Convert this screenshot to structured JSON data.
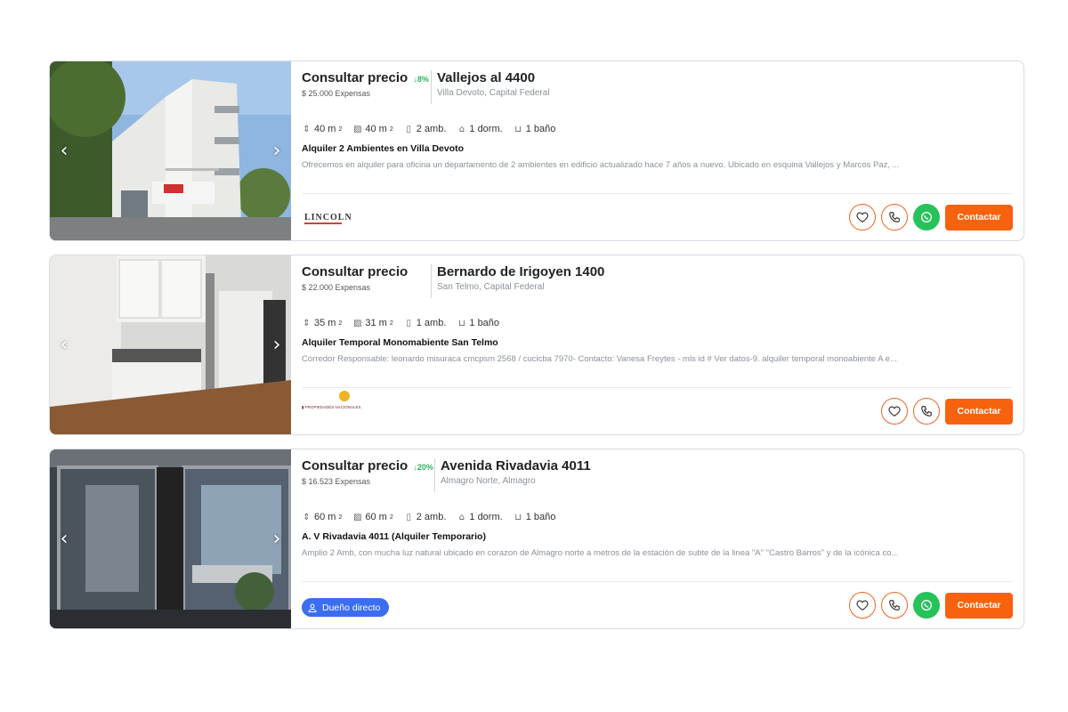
{
  "colors": {
    "accent": "#f7620e",
    "drop": "#2fb35a",
    "whatsapp": "#25c35a",
    "owner_badge": "#3a6df0"
  },
  "listings": [
    {
      "price": "Consultar precio",
      "price_drop": "8%",
      "expensas": "$ 25.000 Expensas",
      "address": "Vallejos al 4400",
      "location": "Villa Devoto, Capital Federal",
      "features": {
        "total": "40 m",
        "covered": "40 m",
        "rooms": "2 amb.",
        "bedrooms": "1 dorm.",
        "baths": "1 baño"
      },
      "title": "Alquiler 2 Ambientes en Villa Devoto",
      "description": "Ofrecemos en alquiler para oficina un departamento de 2 ambientes en edificio actualizado hace 7 años a nuevo. Ubicado en esquina Vallejos y Marcos Paz, ...",
      "publisher": "LINCOLN",
      "contact_label": "Contactar"
    },
    {
      "price": "Consultar precio",
      "expensas": "$ 22.000 Expensas",
      "address": "Bernardo de Irigoyen 1400",
      "location": "San Telmo, Capital Federal",
      "features": {
        "total": "35 m",
        "covered": "31 m",
        "rooms": "1 amb.",
        "baths": "1 baño"
      },
      "title": "Alquiler Temporal Monomabiente San Telmo",
      "description": "Corredor Responsable: leonardo misuraca cmcpsm 2568 / cucicba 7970- Contacto: Vanesa Freytes - mls id # Ver datos-9. alquiler temporal monoabiente A e...",
      "contact_label": "Contactar"
    },
    {
      "price": "Consultar precio",
      "price_drop": "20%",
      "expensas": "$ 16.523 Expensas",
      "address": "Avenida Rivadavia 4011",
      "location": "Almagro Norte, Almagro",
      "features": {
        "total": "60 m",
        "covered": "60 m",
        "rooms": "2 amb.",
        "bedrooms": "1 dorm.",
        "baths": "1 baño"
      },
      "title": "A. V Rivadavia 4011 (Alquiler Temporario)",
      "description": "Amplio 2 Amb, con mucha luz natural ubicado en corazon de Almagro norte a metros de la estación de subte de la linea \"A\" \"Castro Barros\" y de la icónica co...",
      "owner_badge": "Dueño directo",
      "contact_label": "Contactar"
    }
  ]
}
